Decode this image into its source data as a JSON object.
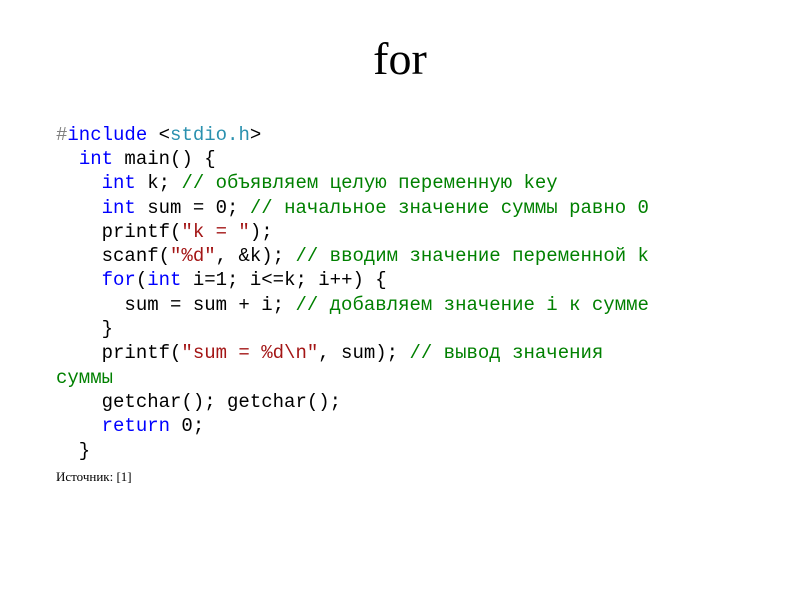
{
  "title": "for",
  "code": {
    "hash": "#",
    "include": "include",
    "hdr_open": " <",
    "hdr_name": "stdio.h",
    "hdr_close": ">",
    "int": "int",
    "main_sig": " main() {",
    "k_decl": " k; ",
    "c_key": "// объявляем целую переменную key",
    "sum_decl": " sum = 0; ",
    "c_init": "// начальное значение суммы равно 0",
    "printf1a": "    printf(",
    "s_k": "\"k = \"",
    "printf1b": ");",
    "scanf_a": "    scanf(",
    "s_d": "\"%d\"",
    "scanf_b": ", &k); ",
    "c_scan": "// вводим значение переменной k",
    "for": "for",
    "for_a": "(",
    "for_b": " i=1; i<=k; i++) {",
    "sum_line": "      sum = sum + i; ",
    "c_sum": "// добавляем значение i к сумме",
    "brace_close1": "    }",
    "printf2a": "    printf(",
    "s_out": "\"sum = %d\\n\"",
    "printf2b": ", sum); ",
    "c_out": "// вывод значения",
    "c_out2": "суммы",
    "getchar": "    getchar(); getchar();",
    "return": "return",
    "ret_tail": " 0;",
    "brace_close2": "  }"
  },
  "source": "Источник: [1]"
}
